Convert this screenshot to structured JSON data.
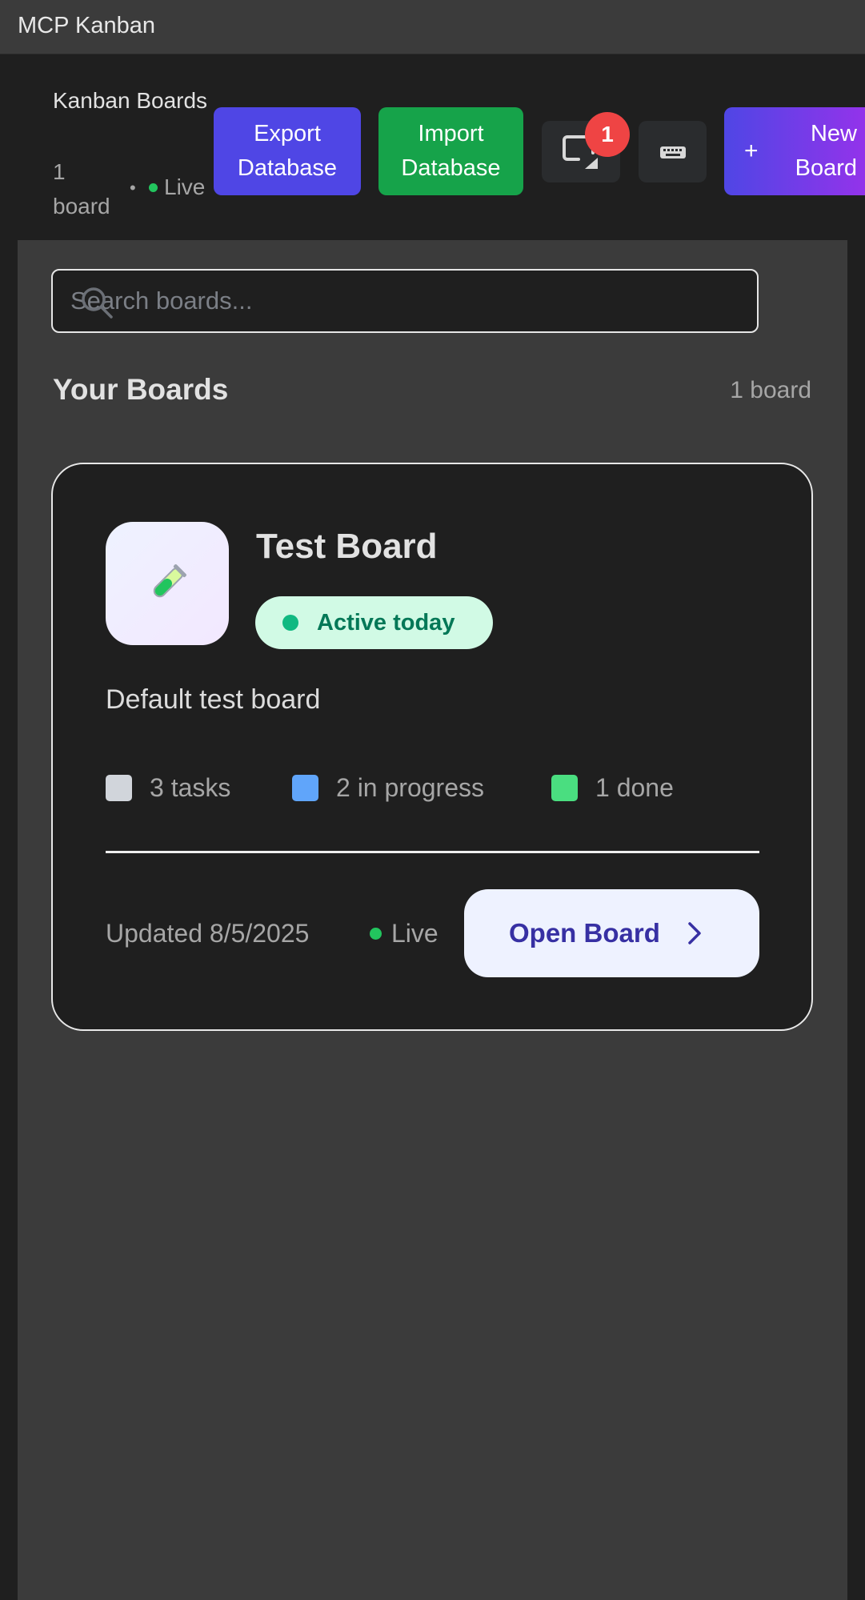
{
  "window": {
    "title": "MCP Kanban"
  },
  "header": {
    "brand": "Kanban Boards",
    "board_count": "1 board",
    "separator": "•",
    "live_label": "Live",
    "export_label": "Export Database",
    "import_label": "Import Database",
    "notification_count": "1",
    "new_board_icon": "+",
    "new_board_label": "New Board"
  },
  "search": {
    "placeholder": "Search boards..."
  },
  "section": {
    "title": "Your Boards",
    "count": "1 board"
  },
  "board": {
    "emoji": "🧪",
    "title": "Test Board",
    "status": "Active today",
    "description": "Default test board",
    "stats": {
      "tasks": "3 tasks",
      "in_progress": "2 in progress",
      "done": "1 done"
    },
    "updated": "Updated 8/5/2025",
    "live_label": "Live",
    "open_label": "Open Board"
  },
  "colors": {
    "accent": "#4f46e5",
    "import": "#16a34a",
    "live": "#22c55e",
    "badge": "#ef4444",
    "stat_tasks": "#d1d5db",
    "stat_progress": "#60a5fa",
    "stat_done": "#4ade80"
  }
}
